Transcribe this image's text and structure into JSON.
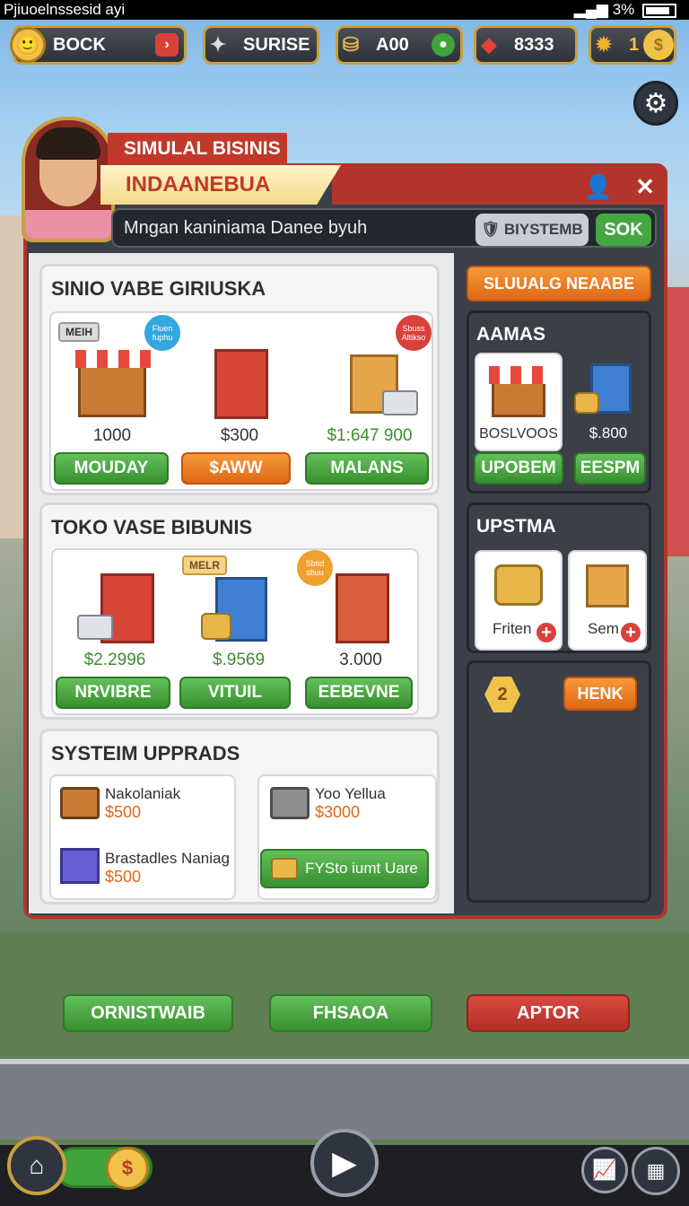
{
  "statusbar": {
    "left_text": "Pjiuoelnssesid ayi",
    "right_text": "3%"
  },
  "hud": {
    "back_label": "BOCK",
    "surise_label": "SURISE",
    "coins_label": "A00",
    "gems_label": "8333",
    "level_value": "1"
  },
  "profile": {
    "ribbon_top": "SIMULAL BISINIS",
    "ribbon_main": "INDAANEBUA",
    "subtitle": "Mngan kaniniama Danee byuh",
    "system_button": "BIYSTEMB",
    "ok_button": "SOK"
  },
  "section1": {
    "title": "SINIO VABE GIRIUSKA",
    "tag": "MEIH",
    "badge_left": "Fluen fuphu",
    "badge_right": "Sbuss Altikso",
    "items": [
      {
        "price": "1000",
        "button": "MOUDAY"
      },
      {
        "price": "$300",
        "button": "$AWW"
      },
      {
        "price": "$1:647 900",
        "button": "MALANS"
      }
    ]
  },
  "section2": {
    "title": "TOKO VASE BIBUNIS",
    "tag": "MELR",
    "badge": "Sbtid sbuu",
    "items": [
      {
        "price": "$2.2996",
        "button": "NRVIBRE"
      },
      {
        "price": "$.9569",
        "button": "VITUIL"
      },
      {
        "price": "3.000",
        "button": "EEBEVNE"
      }
    ]
  },
  "section3": {
    "title": "SYSTEIM UPPRADS",
    "left_items": [
      {
        "name": "Nakolaniak",
        "price": "$500"
      },
      {
        "name": "Brastadles Naniag",
        "price": "$500"
      }
    ],
    "right_item": {
      "name": "Yoo Yellua",
      "price": "$3000"
    },
    "action_button": "FYSto iumt Uare"
  },
  "right_panel": {
    "orange_button": "SLUUALG NEAABE",
    "aamas": {
      "title": "AAMAS",
      "items": [
        {
          "label": "BOSLVOOS",
          "button": "UPOBEM"
        },
        {
          "label": "$.800",
          "button": "EESPM"
        }
      ]
    },
    "upstma": {
      "title": "UPSTMA",
      "items": [
        {
          "label": "Friten"
        },
        {
          "label": "Sem"
        }
      ]
    },
    "level_badge": "2",
    "henk_button": "HENK"
  },
  "bottom_buttons": {
    "left": "ORNISTWAIB",
    "middle": "FHSAOA",
    "right": "APTOR"
  },
  "colors": {
    "accent_red": "#b2352c",
    "green": "#44a741",
    "orange": "#e06716",
    "gold": "#c9a040"
  },
  "icons": [
    "home-icon",
    "coin-icon",
    "play-icon",
    "grid-icon",
    "chart-icon",
    "gear-icon",
    "user-icon",
    "close-icon"
  ]
}
